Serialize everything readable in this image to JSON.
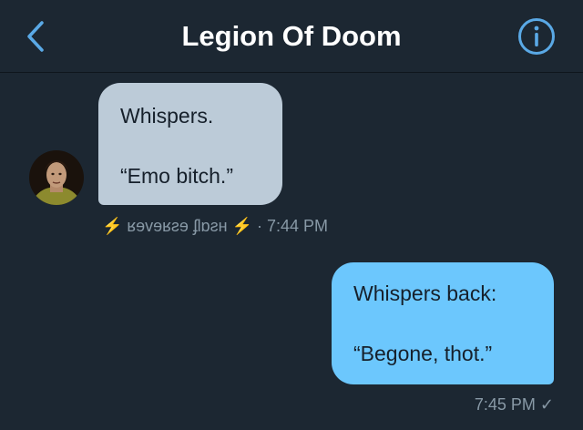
{
  "header": {
    "title": "Legion Of Doom",
    "back_icon": "chevron-left-icon",
    "info_icon": "info-icon",
    "accent": "#5aa9e6"
  },
  "messages": [
    {
      "direction": "incoming",
      "lines": [
        "Whispers.",
        "",
        "“Emo bitch.”"
      ],
      "sender_name": "⚡️ ʁɘvɘʁƨɘ ʄlɒƨн ⚡️",
      "separator": " · ",
      "time": "7:44 PM",
      "bubble_color": "#bccbd8"
    },
    {
      "direction": "outgoing",
      "lines": [
        "Whispers back:",
        "",
        "“Begone, thot.”"
      ],
      "time": "7:45 PM",
      "status_mark": "✓",
      "bubble_color": "#6cc7fd"
    }
  ],
  "colors": {
    "background": "#1c2732",
    "meta_text": "#8899a6",
    "header_text": "#ffffff"
  }
}
